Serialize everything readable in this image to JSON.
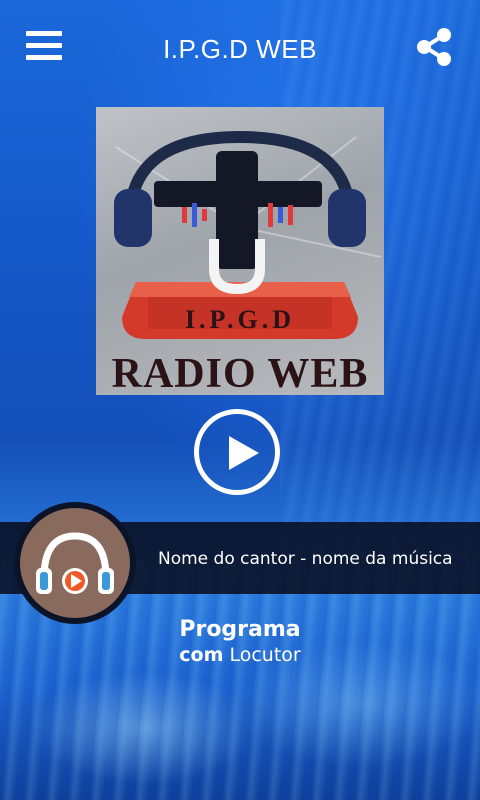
{
  "header": {
    "title": "I.P.G.D WEB",
    "menu_icon": "hamburger-menu-icon",
    "share_icon": "share-icon"
  },
  "logo": {
    "ipgd_text": "I.P.G.D",
    "radio_text": "RADIO WEB"
  },
  "player": {
    "play_icon": "play-icon",
    "now_playing": "Nome do cantor - nome da música"
  },
  "program": {
    "name": "Programa",
    "host_prefix": "com",
    "host": "Locutor"
  },
  "colors": {
    "background": "#1a5fd0",
    "now_playing_bar": "#080e20",
    "avatar_bg": "#8a6a5c",
    "accent_orange": "#f05a28",
    "headphone_blue": "#3a9ad9"
  }
}
